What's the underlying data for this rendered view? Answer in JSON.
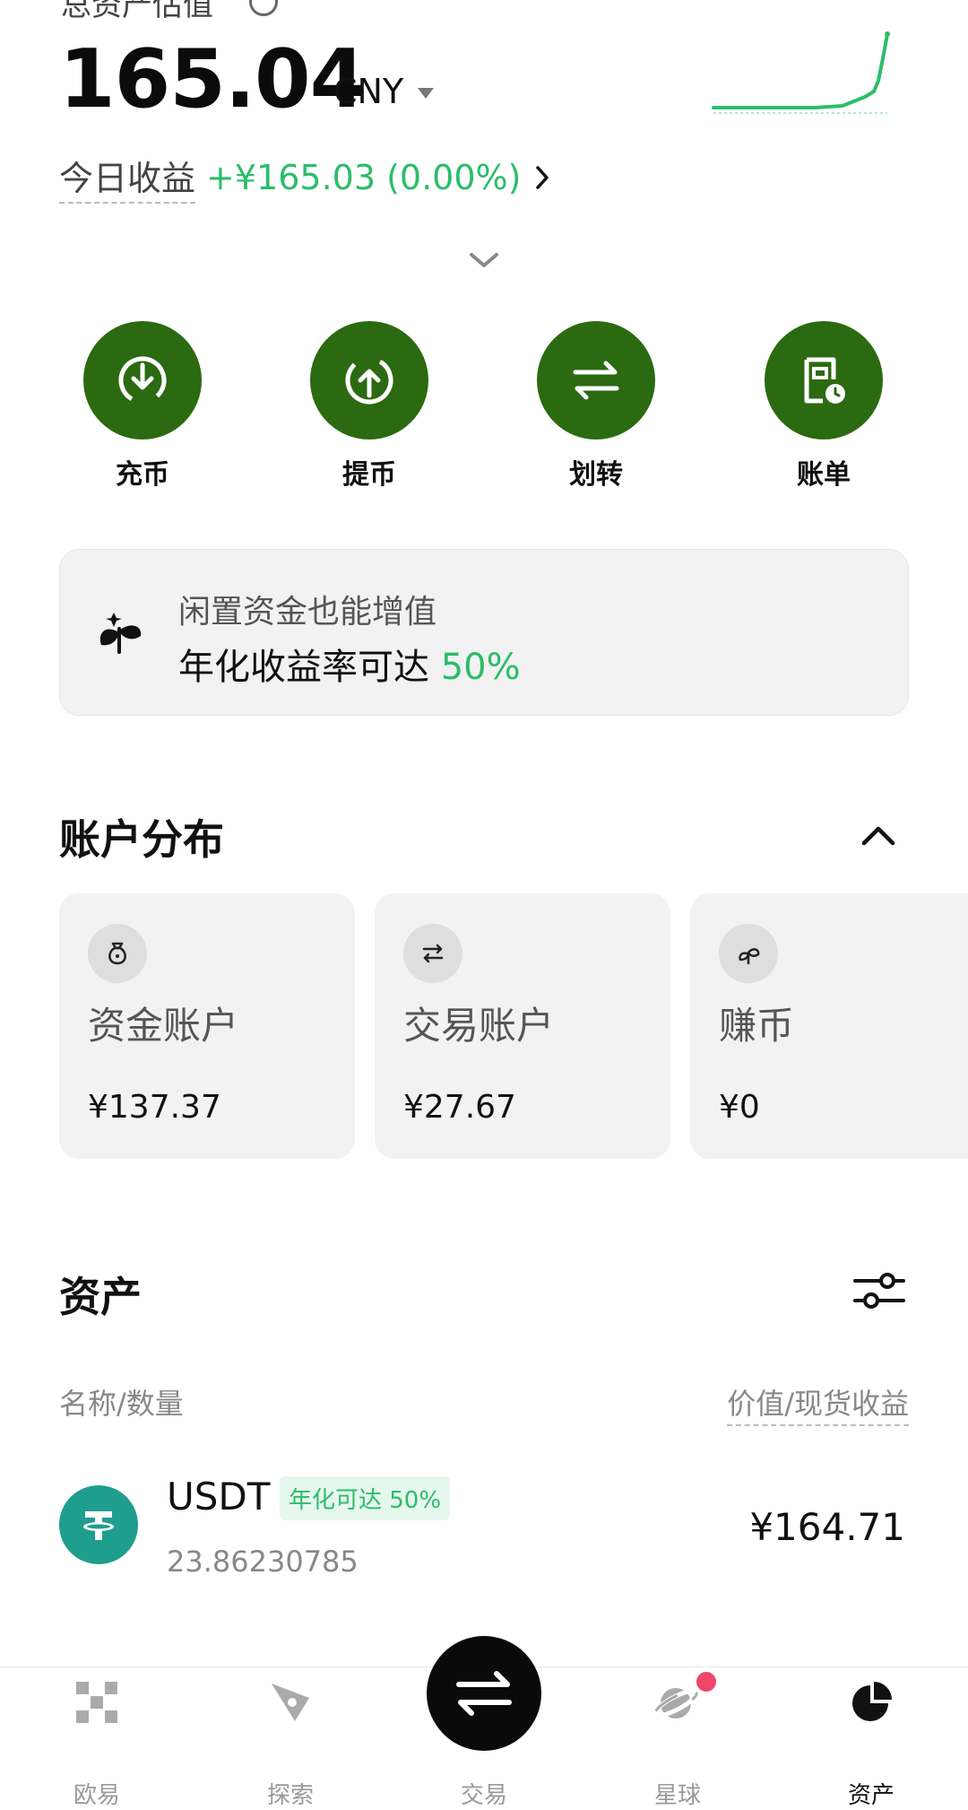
{
  "header": {
    "balance_label": "总资产估值",
    "total_value": "165.04",
    "currency": "CNY",
    "today_label": "今日收益",
    "today_value": "+¥165.03 (0.00%)"
  },
  "actions": [
    {
      "label": "充币",
      "icon": "deposit-icon"
    },
    {
      "label": "提币",
      "icon": "withdraw-icon"
    },
    {
      "label": "划转",
      "icon": "transfer-icon"
    },
    {
      "label": "账单",
      "icon": "bill-icon"
    }
  ],
  "promo": {
    "subtitle": "闲置资金也能增值",
    "main_text": "年化收益率可达",
    "rate": "50%",
    "icon": "sprout-icon"
  },
  "accounts_section": {
    "title": "账户分布",
    "cards": [
      {
        "name": "资金账户",
        "amount": "¥137.37",
        "icon": "money-bag-icon"
      },
      {
        "name": "交易账户",
        "amount": "¥27.67",
        "icon": "exchange-icon"
      },
      {
        "name": "赚币",
        "amount": "¥0",
        "icon": "earn-icon"
      }
    ]
  },
  "assets_section": {
    "title": "资产",
    "col_left": "名称/数量",
    "col_right": "价值/现货收益",
    "items": [
      {
        "symbol": "USDT",
        "badge": "年化可达 50%",
        "quantity": "23.86230785",
        "value": "¥164.71"
      }
    ]
  },
  "nav": {
    "items": [
      {
        "label": "欧易",
        "icon": "home-grid-icon"
      },
      {
        "label": "探索",
        "icon": "discover-icon"
      },
      {
        "label": "交易",
        "icon": "trade-swap-icon"
      },
      {
        "label": "星球",
        "icon": "planet-icon"
      },
      {
        "label": "资产",
        "icon": "assets-pie-icon"
      }
    ]
  },
  "colors": {
    "accent_green": "#2bbd6a",
    "action_green": "#2b6a10",
    "usdt_teal": "#1f9e8e",
    "badge_red": "#f0466b"
  }
}
